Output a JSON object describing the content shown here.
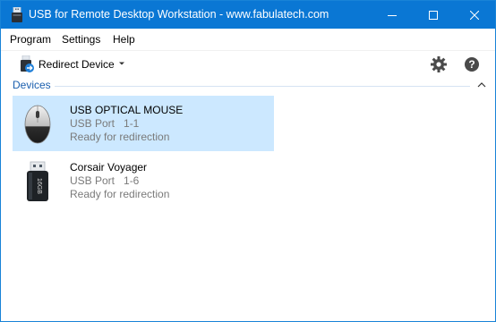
{
  "window": {
    "title": "USB for Remote Desktop Workstation - www.fabulatech.com",
    "accent_color": "#0a77d4"
  },
  "menu": {
    "items": [
      "Program",
      "Settings",
      "Help"
    ]
  },
  "toolbar": {
    "redirect_label": "Redirect Device",
    "settings_icon": "gear-icon",
    "help_icon": "help-icon"
  },
  "devices": {
    "section_label": "Devices",
    "items": [
      {
        "name": "USB OPTICAL MOUSE",
        "port_label": "USB Port",
        "port": "1-1",
        "status": "Ready for redirection",
        "icon": "mouse-icon",
        "selected": true
      },
      {
        "name": "Corsair Voyager",
        "port_label": "USB Port",
        "port": "1-6",
        "status": "Ready for redirection",
        "icon": "usb-drive-icon",
        "capacity": "16GB",
        "selected": false
      }
    ]
  }
}
